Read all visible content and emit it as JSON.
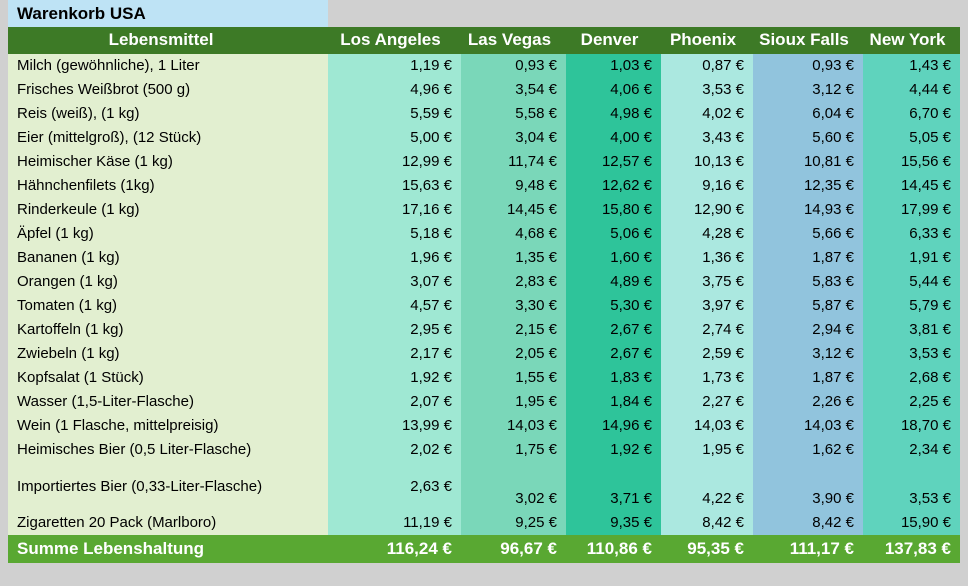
{
  "title": "Warenkorb USA",
  "table": {
    "headers": {
      "item": "Lebensmittel",
      "cities": [
        "Los Angeles",
        "Las Vegas",
        "Denver",
        "Phoenix",
        "Sioux Falls",
        "New York"
      ]
    },
    "rows": [
      {
        "item": "Milch (gewöhnliche), 1 Liter",
        "values": [
          "1,19 €",
          "0,93 €",
          "1,03 €",
          "0,87 €",
          "0,93 €",
          "1,43 €"
        ]
      },
      {
        "item": "Frisches Weißbrot (500 g)",
        "values": [
          "4,96 €",
          "3,54 €",
          "4,06 €",
          "3,53 €",
          "3,12 €",
          "4,44 €"
        ]
      },
      {
        "item": "Reis (weiß), (1 kg)",
        "values": [
          "5,59 €",
          "5,58 €",
          "4,98 €",
          "4,02 €",
          "6,04 €",
          "6,70 €"
        ]
      },
      {
        "item": "Eier (mittelgroß), (12 Stück)",
        "values": [
          "5,00 €",
          "3,04 €",
          "4,00 €",
          "3,43 €",
          "5,60 €",
          "5,05 €"
        ]
      },
      {
        "item": "Heimischer Käse (1 kg)",
        "values": [
          "12,99 €",
          "11,74 €",
          "12,57 €",
          "10,13 €",
          "10,81 €",
          "15,56 €"
        ]
      },
      {
        "item": "Hähnchenfilets (1kg)",
        "values": [
          "15,63 €",
          "9,48 €",
          "12,62 €",
          "9,16 €",
          "12,35 €",
          "14,45 €"
        ]
      },
      {
        "item": "Rinderkeule (1 kg)",
        "values": [
          "17,16 €",
          "14,45 €",
          "15,80 €",
          "12,90 €",
          "14,93 €",
          "17,99 €"
        ]
      },
      {
        "item": "Äpfel (1 kg)",
        "values": [
          "5,18 €",
          "4,68 €",
          "5,06 €",
          "4,28 €",
          "5,66 €",
          "6,33 €"
        ]
      },
      {
        "item": "Bananen (1 kg)",
        "values": [
          "1,96 €",
          "1,35 €",
          "1,60 €",
          "1,36 €",
          "1,87 €",
          "1,91 €"
        ]
      },
      {
        "item": "Orangen (1 kg)",
        "values": [
          "3,07 €",
          "2,83 €",
          "4,89 €",
          "3,75 €",
          "5,83 €",
          "5,44 €"
        ]
      },
      {
        "item": "Tomaten (1 kg)",
        "values": [
          "4,57 €",
          "3,30 €",
          "5,30 €",
          "3,97 €",
          "5,87 €",
          "5,79 €"
        ]
      },
      {
        "item": "Kartoffeln (1 kg)",
        "values": [
          "2,95 €",
          "2,15 €",
          "2,67 €",
          "2,74 €",
          "2,94 €",
          "3,81 €"
        ]
      },
      {
        "item": "Zwiebeln (1 kg)",
        "values": [
          "2,17 €",
          "2,05 €",
          "2,67 €",
          "2,59 €",
          "3,12 €",
          "3,53 €"
        ]
      },
      {
        "item": "Kopfsalat (1 Stück)",
        "values": [
          "1,92 €",
          "1,55 €",
          "1,83 €",
          "1,73 €",
          "1,87 €",
          "2,68 €"
        ]
      },
      {
        "item": "Wasser (1,5-Liter-Flasche)",
        "values": [
          "2,07 €",
          "1,95 €",
          "1,84 €",
          "2,27 €",
          "2,26 €",
          "2,25 €"
        ]
      },
      {
        "item": "Wein (1 Flasche, mittelpreisig)",
        "values": [
          "13,99 €",
          "14,03 €",
          "14,96 €",
          "14,03 €",
          "14,03 €",
          "18,70 €"
        ]
      },
      {
        "item": "Heimisches Bier (0,5 Liter-Flasche)",
        "values": [
          "2,02 €",
          "1,75 €",
          "1,92 €",
          "1,95 €",
          "1,62 €",
          "2,34 €"
        ]
      },
      {
        "item": "Importiertes Bier (0,33-Liter-Flasche)",
        "values": [
          "2,63 €",
          "3,02 €",
          "3,71 €",
          "4,22 €",
          "3,90 €",
          "3,53 €"
        ],
        "tall": true
      },
      {
        "item": "Zigaretten 20 Pack (Marlboro)",
        "values": [
          "11,19 €",
          "9,25 €",
          "9,35 €",
          "8,42 €",
          "8,42 €",
          "15,90 €"
        ]
      }
    ],
    "summary": {
      "label": "Summe Lebenshaltung",
      "values": [
        "116,24 €",
        "96,67 €",
        "110,86 €",
        "95,35 €",
        "111,17 €",
        "137,83 €"
      ]
    }
  },
  "colors": {
    "page_background": "#d0d0d0",
    "title_background": "#bee3f5",
    "header_green": "#3d7a26",
    "summary_green": "#59a832",
    "name_column": "#e2efd0",
    "col_los_angeles": "#9fe8d3",
    "col_las_vegas": "#7ad7b9",
    "col_denver": "#2ec49a",
    "col_phoenix": "#abe8e0",
    "col_sioux_falls": "#91c4dd",
    "col_new_york": "#5fd3bd"
  }
}
